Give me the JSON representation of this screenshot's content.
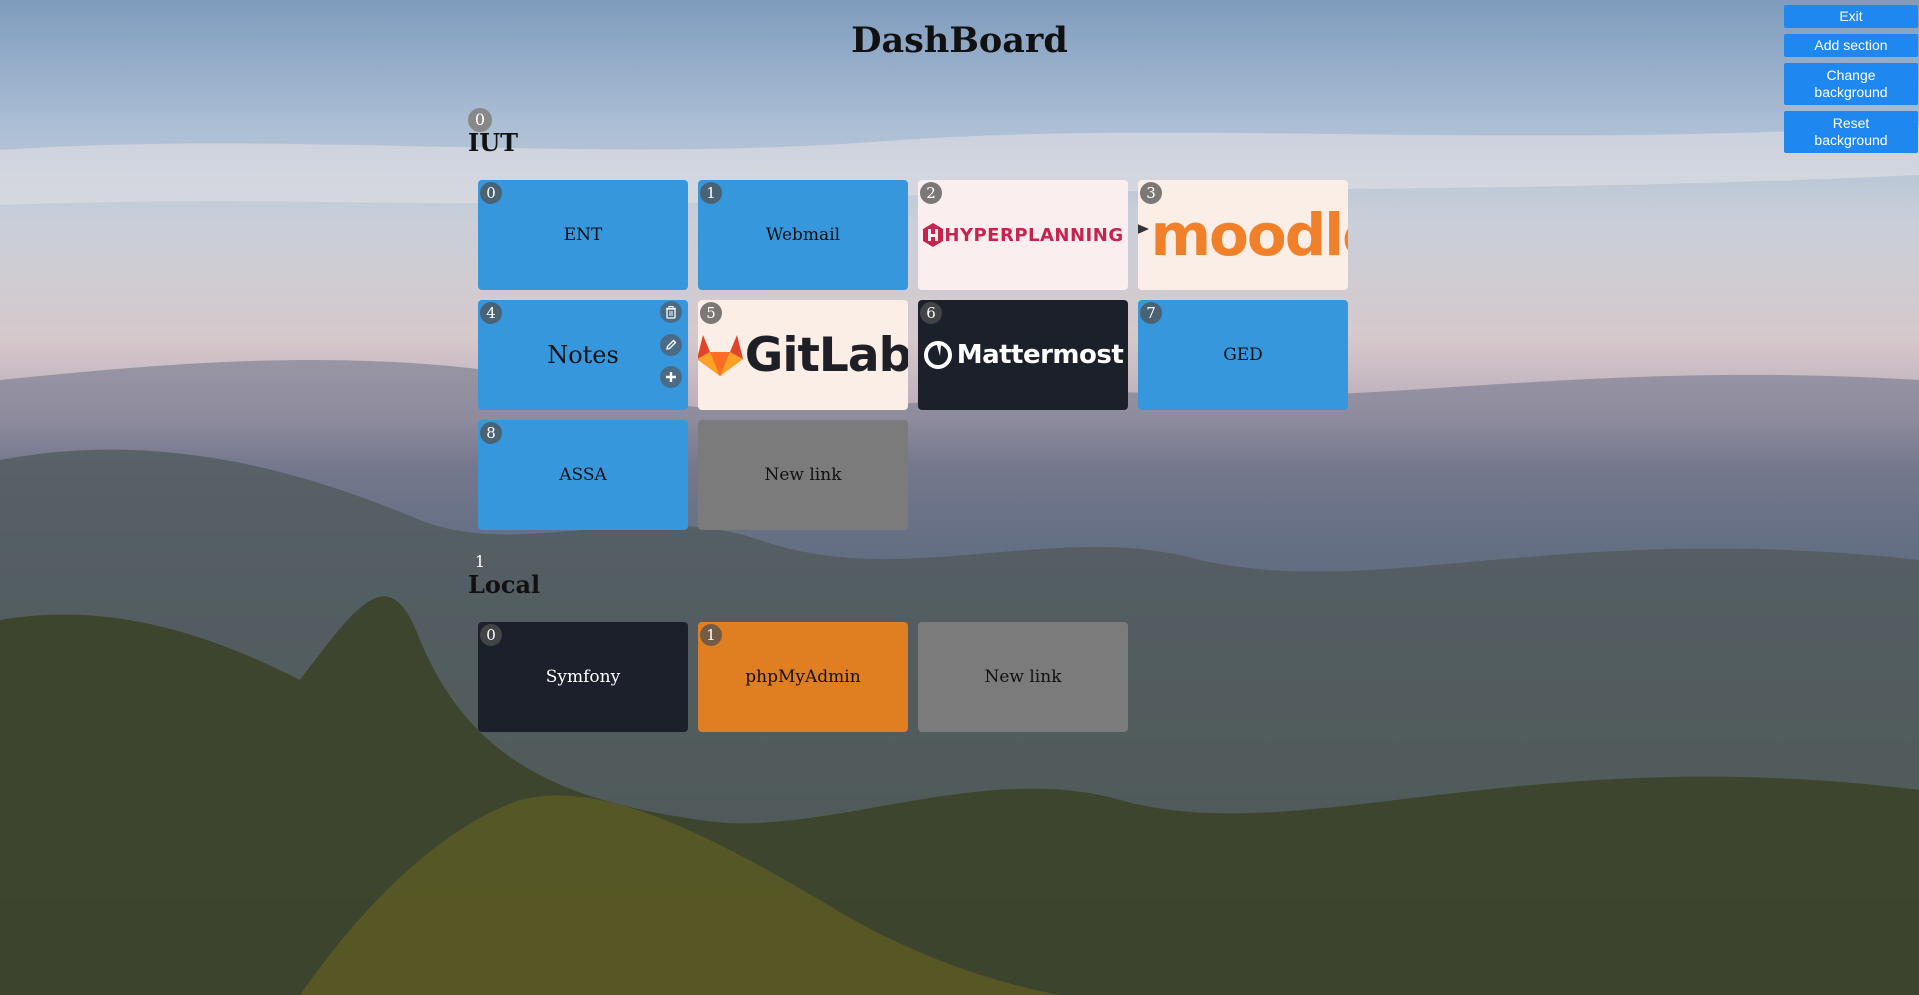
{
  "page": {
    "title": "DashBoard"
  },
  "controls": {
    "exit": "Exit",
    "add_section": "Add section",
    "change_background_1": "Change",
    "change_background_2": "background",
    "reset_background_1": "Reset",
    "reset_background_2": "background"
  },
  "sections": [
    {
      "index": "0",
      "title": "IUT",
      "tiles": [
        {
          "index": "0",
          "label": "ENT",
          "style": "blue"
        },
        {
          "index": "1",
          "label": "Webmail",
          "style": "blue"
        },
        {
          "index": "2",
          "label": "HYPERPLANNING",
          "style": "logo",
          "logo": "hyperplanning-logo"
        },
        {
          "index": "3",
          "label": "moodle",
          "style": "logo",
          "logo": "moodle-logo"
        },
        {
          "index": "4",
          "label": "Notes",
          "style": "blue",
          "tools": [
            "trash-icon",
            "pencil-icon",
            "plus-icon"
          ]
        },
        {
          "index": "5",
          "label": "GitLab",
          "style": "logo",
          "logo": "gitlab-logo"
        },
        {
          "index": "6",
          "label": "Mattermost",
          "style": "logo",
          "logo": "mattermost-logo"
        },
        {
          "index": "7",
          "label": "GED",
          "style": "blue"
        },
        {
          "index": "8",
          "label": "ASSA",
          "style": "blue"
        },
        {
          "label": "New link",
          "style": "grey"
        }
      ]
    },
    {
      "index": "1",
      "title": "Local",
      "tiles": [
        {
          "index": "0",
          "label": "Symfony",
          "style": "dark"
        },
        {
          "index": "1",
          "label": "phpMyAdmin",
          "style": "orange"
        },
        {
          "label": "New link",
          "style": "grey"
        }
      ]
    }
  ],
  "colors": {
    "tile_blue": "#3797dd",
    "tile_grey": "#7b7b7b",
    "tile_dark": "#1b202b",
    "tile_orange": "#e07f22",
    "button_blue": "#1f87f0"
  }
}
